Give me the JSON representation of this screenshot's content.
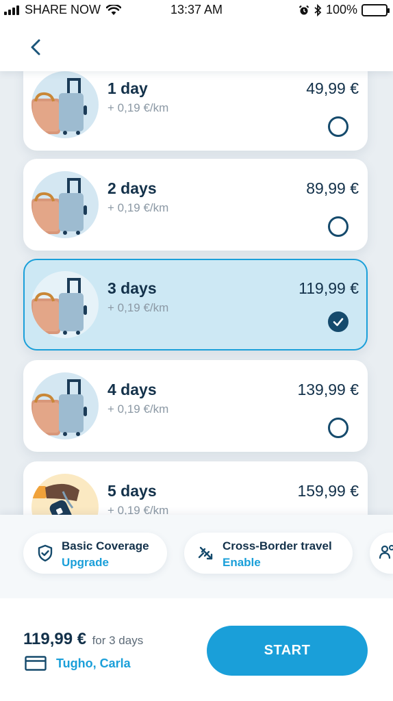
{
  "status_bar": {
    "carrier": "SHARE NOW",
    "time": "13:37 AM",
    "battery": "100%"
  },
  "header": {
    "back_icon": "chevron-left-icon"
  },
  "packages": [
    {
      "title": "1 day",
      "subtitle": "+ 0,19 €/km",
      "price": "49,99 €",
      "selected": false,
      "illustration": "luggage"
    },
    {
      "title": "2 days",
      "subtitle": "+ 0,19 €/km",
      "price": "89,99 €",
      "selected": false,
      "illustration": "luggage"
    },
    {
      "title": "3 days",
      "subtitle": "+ 0,19 €/km",
      "price": "119,99 €",
      "selected": true,
      "illustration": "luggage"
    },
    {
      "title": "4 days",
      "subtitle": "+ 0,19 €/km",
      "price": "139,99 €",
      "selected": false,
      "illustration": "luggage"
    },
    {
      "title": "5 days",
      "subtitle": "+ 0,19 €/km",
      "price": "159,99 €",
      "selected": false,
      "illustration": "car-key"
    }
  ],
  "options": [
    {
      "title": "Basic Coverage",
      "action": "Upgrade",
      "icon": "shield-check-icon"
    },
    {
      "title": "Cross-Border travel",
      "action": "Enable",
      "icon": "border-crossing-icon"
    },
    {
      "title": "",
      "action": "",
      "icon": "people-icon"
    }
  ],
  "footer": {
    "total_price": "119,99 €",
    "total_period": "for 3 days",
    "payment_name": "Tugho, Carla",
    "payment_icon": "credit-card-icon",
    "start_label": "START"
  },
  "colors": {
    "accent": "#1a9fd9",
    "navy": "#13314a",
    "selected_bg": "#cde8f4"
  }
}
